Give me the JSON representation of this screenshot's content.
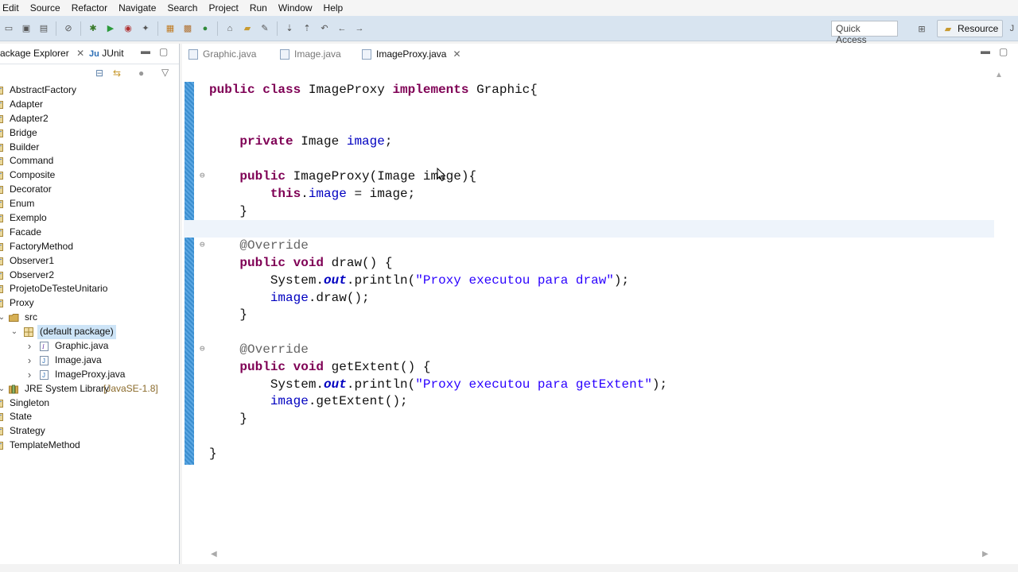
{
  "menu": [
    "Edit",
    "Source",
    "Refactor",
    "Navigate",
    "Search",
    "Project",
    "Run",
    "Window",
    "Help"
  ],
  "toolbar": {
    "quick_access": "Quick Access",
    "perspective": "Resource"
  },
  "left_panel": {
    "tabs": [
      {
        "label": "ackage Explorer",
        "close": "✕"
      },
      {
        "label": "JUnit",
        "prefix": "Ju"
      }
    ],
    "tree": [
      {
        "label": "AbstractFactory",
        "level": 0,
        "type": "project"
      },
      {
        "label": "Adapter",
        "level": 0,
        "type": "project"
      },
      {
        "label": "Adapter2",
        "level": 0,
        "type": "project"
      },
      {
        "label": "Bridge",
        "level": 0,
        "type": "project"
      },
      {
        "label": "Builder",
        "level": 0,
        "type": "project"
      },
      {
        "label": "Command",
        "level": 0,
        "type": "project"
      },
      {
        "label": "Composite",
        "level": 0,
        "type": "project"
      },
      {
        "label": "Decorator",
        "level": 0,
        "type": "project"
      },
      {
        "label": "Enum",
        "level": 0,
        "type": "project"
      },
      {
        "label": "Exemplo",
        "level": 0,
        "type": "project"
      },
      {
        "label": "Facade",
        "level": 0,
        "type": "project"
      },
      {
        "label": "FactoryMethod",
        "level": 0,
        "type": "project"
      },
      {
        "label": "Observer1",
        "level": 0,
        "type": "project"
      },
      {
        "label": "Observer2",
        "level": 0,
        "type": "project"
      },
      {
        "label": "ProjetoDeTesteUnitario",
        "level": 0,
        "type": "project"
      },
      {
        "label": "Proxy",
        "level": 0,
        "type": "project"
      },
      {
        "label": "src",
        "level": 1,
        "type": "src"
      },
      {
        "label": "(default package)",
        "level": 2,
        "type": "package",
        "selected": true
      },
      {
        "label": "Graphic.java",
        "level": 3,
        "type": "interface"
      },
      {
        "label": "Image.java",
        "level": 3,
        "type": "class"
      },
      {
        "label": "ImageProxy.java",
        "level": 3,
        "type": "class"
      },
      {
        "label": "JRE System Library",
        "suffix": "[JavaSE-1.8]",
        "level": 1,
        "type": "library"
      },
      {
        "label": "Singleton",
        "level": 0,
        "type": "project"
      },
      {
        "label": "State",
        "level": 0,
        "type": "project"
      },
      {
        "label": "Strategy",
        "level": 0,
        "type": "project"
      },
      {
        "label": "TemplateMethod",
        "level": 0,
        "type": "project"
      }
    ]
  },
  "editor": {
    "tabs": [
      {
        "label": "Graphic.java",
        "active": false
      },
      {
        "label": "Image.java",
        "active": false
      },
      {
        "label": "ImageProxy.java",
        "active": true,
        "close": "✕"
      }
    ]
  },
  "colors": {
    "keyword": "#7f0055",
    "field": "#0000c0",
    "string": "#2a00ff",
    "annotation": "#646464",
    "toolbar": "#d8e4f0",
    "selection": "#cde4f7"
  }
}
